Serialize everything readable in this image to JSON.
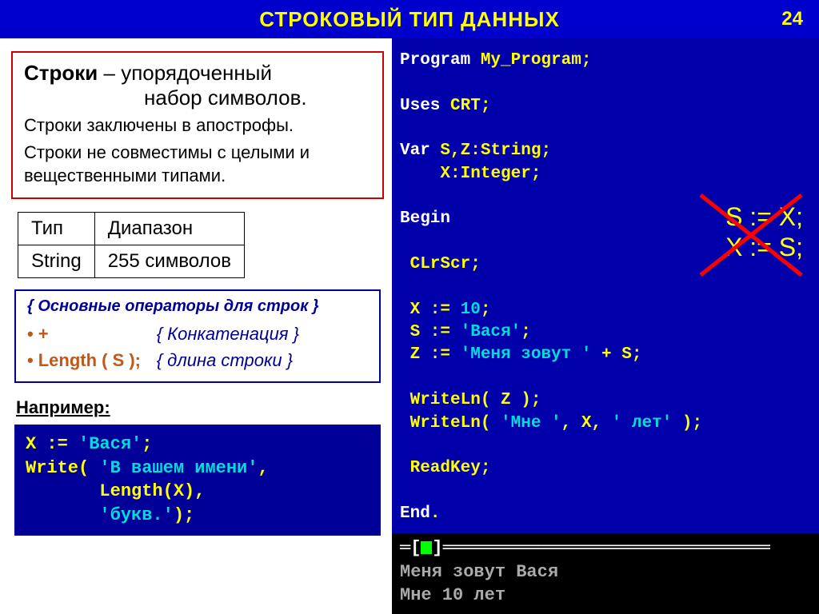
{
  "header": {
    "title": "СТРОКОВЫЙ ТИП ДАННЫХ",
    "page": "24"
  },
  "definition": {
    "term": "Строки",
    "rest": " – упорядоченный",
    "line2": "набор символов.",
    "sub1": "Строки заключены в апострофы.",
    "sub2": "Строки не совместимы с целыми и вещественными типами."
  },
  "table": {
    "h1": "Тип",
    "h2": "Диапазон",
    "r1c1": "String",
    "r1c2": "255 символов"
  },
  "ops": {
    "title": "{ Основные операторы для строк }",
    "op1": "+",
    "cm1": "{ Конкатенация }",
    "op2": "Length ( S );",
    "cm2": "{ длина строки }"
  },
  "example_label": "Например:",
  "example": {
    "l1a": "X := ",
    "l1b": "'Вася'",
    "l1c": ";",
    "l2a": "Write( ",
    "l2b": "'В вашем имени'",
    "l2c": ",",
    "l3": "       Length(X),",
    "l4a": "       ",
    "l4b": "'букв.'",
    "l4c": ");"
  },
  "code": {
    "l1a": "Program",
    "l1b": " My_Program;",
    "l2a": "Uses ",
    "l2b": "CRT",
    "l2c": ";",
    "l3a": "Var ",
    "l3b": "S,Z",
    "l3c": ":String;",
    "l4a": "    ",
    "l4b": "X",
    "l4c": ":Integer;",
    "l5": "Begin",
    "l6": " CLrScr;",
    "l7a": " X := ",
    "l7b": "10",
    "l7c": ";",
    "l8a": " S := ",
    "l8b": "'Вася'",
    "l8c": ";",
    "l9a": " Z := ",
    "l9b": "'Меня зовут '",
    "l9c": " + S;",
    "l10": " WriteLn( Z );",
    "l11a": " WriteLn( ",
    "l11b": "'Мне '",
    "l11c": ", X, ",
    "l11d": "' лет'",
    "l11e": " );",
    "l12": " ReadKey;",
    "l13a": "End",
    "l13b": "."
  },
  "wrong": {
    "l1": "S := X;",
    "l2": "X := S;"
  },
  "output": {
    "l1": "Меня зовут Вася",
    "l2": "Мне 10 лет"
  }
}
